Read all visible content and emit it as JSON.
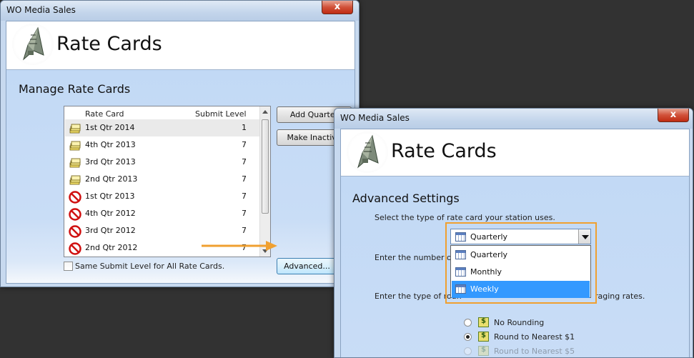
{
  "colors": {
    "accent_orange": "#f0a030",
    "selection_blue": "#3399ff",
    "content_blue": "#c2d9f5"
  },
  "back_window": {
    "title": "WO Media Sales",
    "close_label": "x",
    "header_title": "Rate Cards",
    "section_title": "Manage Rate Cards",
    "list": {
      "columns": [
        "Rate Card",
        "Submit Level"
      ],
      "rows": [
        {
          "name": "1st Qtr 2014",
          "level": "1",
          "icon": "rate-card-stack-icon"
        },
        {
          "name": "4th Qtr 2013",
          "level": "7",
          "icon": "rate-card-stack-icon"
        },
        {
          "name": "3rd Qtr 2013",
          "level": "7",
          "icon": "rate-card-stack-icon"
        },
        {
          "name": "2nd Qtr 2013",
          "level": "7",
          "icon": "rate-card-stack-icon"
        },
        {
          "name": "1st Qtr 2013",
          "level": "7",
          "icon": "inactive-prohibited-icon"
        },
        {
          "name": "4th Qtr 2012",
          "level": "7",
          "icon": "inactive-prohibited-icon"
        },
        {
          "name": "3rd Qtr 2012",
          "level": "7",
          "icon": "inactive-prohibited-icon"
        },
        {
          "name": "2nd Qtr 2012",
          "level": "7",
          "icon": "inactive-prohibited-icon"
        }
      ]
    },
    "buttons": {
      "add_quarter": "Add Quarter",
      "make_inactive": "Make Inactive",
      "advanced": "Advanced..."
    },
    "checkbox_label": "Same Submit Level for All Rate Cards."
  },
  "front_window": {
    "title": "WO Media Sales",
    "close_label": "x",
    "header_title": "Rate Cards",
    "section_title": "Advanced Settings",
    "prompt_type": "Select the type of rate card your station uses.",
    "prompt_number": "Enter the number of le",
    "prompt_rounding_start": "Enter the type of roun",
    "prompt_rounding_end": "raging rates.",
    "combo_value": "Quarterly",
    "dropdown_options": [
      "Quarterly",
      "Monthly",
      "Weekly"
    ],
    "rounding_options": [
      {
        "label": "No Rounding",
        "selected": false
      },
      {
        "label": "Round to Nearest $1",
        "selected": true
      },
      {
        "label": "Round to Nearest $5",
        "selected": false
      }
    ]
  }
}
